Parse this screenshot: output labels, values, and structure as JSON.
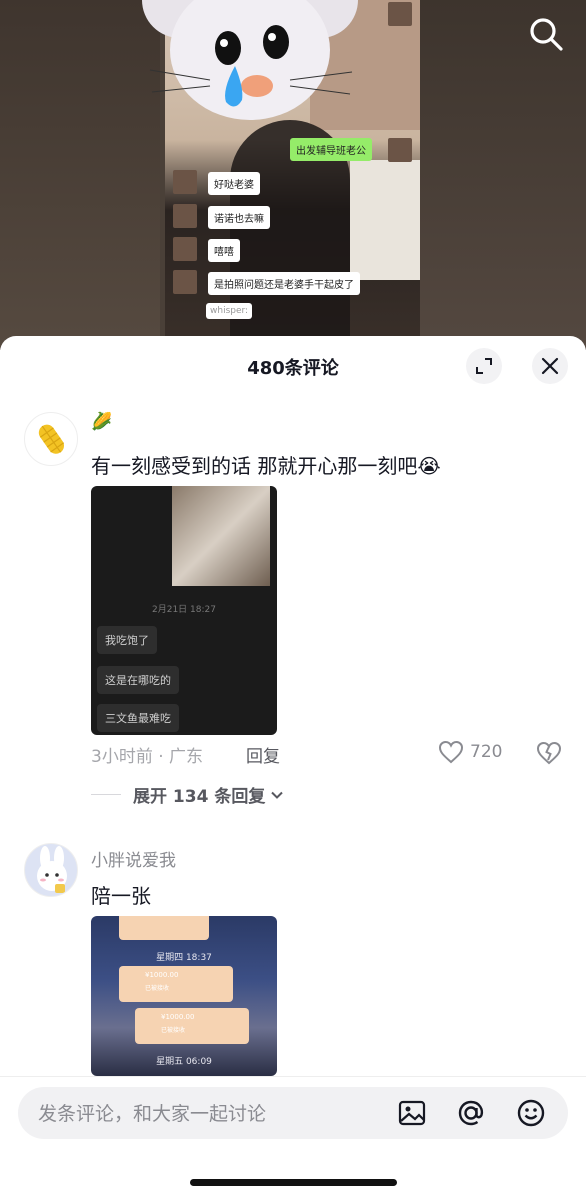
{
  "video": {
    "chat": [
      {
        "text": "出发辅导班老公",
        "side": "right"
      },
      {
        "text": "好哒老婆",
        "side": "left"
      },
      {
        "text": "诺诺也去嘛",
        "side": "left"
      },
      {
        "text": "嘻嘻",
        "side": "left"
      },
      {
        "text": "是拍照问题还是老婆手干起皮了",
        "side": "left"
      },
      {
        "text": "whisper:",
        "side": "left"
      }
    ]
  },
  "sheet": {
    "title": "480条评论"
  },
  "comments": [
    {
      "username": "🌽",
      "text": "有一刻感受到的话 那就开心那一刻吧😭",
      "image_chat": {
        "time": "2月21日 18:27",
        "bubbles": [
          "我吃饱了",
          "这是在哪吃的",
          "三文鱼最难吃"
        ]
      },
      "meta": "3小时前 · 广东",
      "reply_label": "回复",
      "likes": "720",
      "expand_label": "展开 134 条回复"
    },
    {
      "username": "小胖说爱我",
      "text": "陪一张",
      "image_chat": {
        "time1": "星期四 18:37",
        "amount1": "¥1000.00",
        "amount2": "¥1000.00",
        "time2": "星期五 06:09",
        "status": "已被接收"
      }
    }
  ],
  "input": {
    "placeholder": "发条评论，和大家一起讨论"
  },
  "colors": {
    "wechat_green": "#95ec69",
    "text_primary": "#161823",
    "text_secondary": "#8a8b91"
  }
}
